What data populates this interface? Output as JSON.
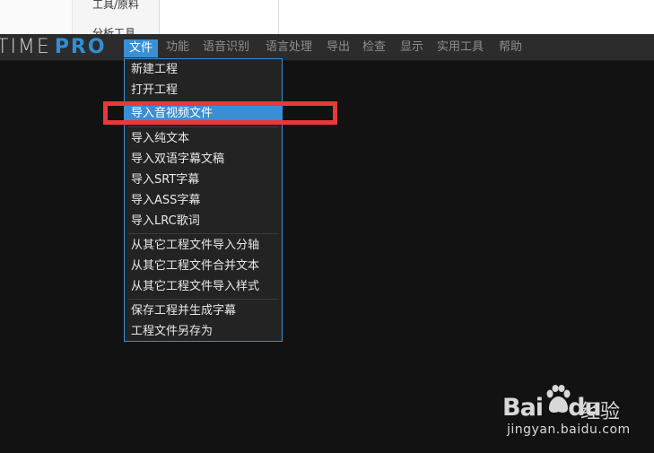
{
  "background_window": {
    "tool_label": "工具/原料",
    "cut_label": "分析工具"
  },
  "app": {
    "logo_word": "TIME",
    "logo_pro": "PRO"
  },
  "menubar": {
    "items": [
      {
        "label": "文件",
        "active": true
      },
      {
        "label": "功能"
      },
      {
        "label": "语音识别"
      },
      {
        "label": "语言处理"
      },
      {
        "label": "导出"
      },
      {
        "label": "检查"
      },
      {
        "label": "显示"
      },
      {
        "label": "实用工具"
      },
      {
        "label": "帮助"
      }
    ]
  },
  "file_menu": {
    "items": [
      {
        "label": "新建工程"
      },
      {
        "label": "打开工程"
      },
      {
        "label": "导入音视频文件",
        "selected": true
      },
      {
        "label": "导入纯文本"
      },
      {
        "label": "导入双语字幕文稿"
      },
      {
        "label": "导入SRT字幕"
      },
      {
        "label": "导入ASS字幕"
      },
      {
        "label": "导入LRC歌词"
      },
      {
        "label": "从其它工程文件导入分轴"
      },
      {
        "label": "从其它工程文件合并文本"
      },
      {
        "label": "从其它工程文件导入样式"
      },
      {
        "label": "保存工程并生成字幕"
      },
      {
        "label": "工程文件另存为"
      }
    ]
  },
  "watermark": {
    "brand": "Bai",
    "brand_du": "du",
    "cn": "经验",
    "url": "jingyan.baidu.com"
  },
  "colors": {
    "accent": "#3a8ed4",
    "highlight": "#e8393a",
    "menubar_bg": "#2c2c2c",
    "canvas_bg": "#121212"
  }
}
